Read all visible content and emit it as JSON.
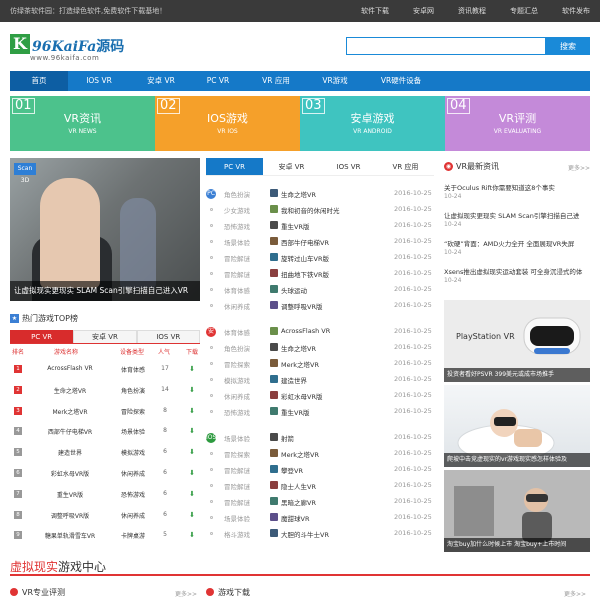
{
  "topbar": {
    "slogan": "仿绿茶软件园：打造绿色软件,免费软件下载基地！",
    "links": [
      "软件下载",
      "安卓网",
      "资讯教程",
      "专题汇总",
      "软件发布"
    ]
  },
  "logo": {
    "k": "K",
    "name_latin": "96KaiFa",
    "name_cn": "源码",
    "url": "www.96kaifa.com"
  },
  "search": {
    "placeholder": "",
    "button": "搜索"
  },
  "nav": [
    "首页",
    "IOS VR",
    "安卓 VR",
    "PC VR",
    "VR 应用",
    "VR游戏",
    "VR硬件设备"
  ],
  "categories": [
    {
      "num": "01",
      "title": "VR资讯",
      "sub": "VR NEWS",
      "color": "#4cc28c"
    },
    {
      "num": "02",
      "title": "IOS游戏",
      "sub": "VR IOS",
      "color": "#f5a02a"
    },
    {
      "num": "03",
      "title": "安卓游戏",
      "sub": "VR ANDROID",
      "color": "#3fc4c0"
    },
    {
      "num": "04",
      "title": "VR评测",
      "sub": "VR EVALUATING",
      "color": "#c48ad9"
    }
  ],
  "banner": {
    "badge": "Scan 3D",
    "caption": "让虚拟现实更现实 SLAM Scan引擎扫描自己进入VR"
  },
  "hot": {
    "title": "热门游戏TOP榜",
    "tabs": [
      "PC VR",
      "安卓 VR",
      "IOS VR"
    ],
    "columns": [
      "排名",
      "游戏名称",
      "设备类型",
      "人气",
      "下载"
    ],
    "rows": [
      {
        "rank": "1",
        "name": "AcrossFlash VR",
        "type": "体育体感",
        "pop": "17"
      },
      {
        "rank": "2",
        "name": "生命之塔VR",
        "type": "角色扮演",
        "pop": "14"
      },
      {
        "rank": "3",
        "name": "Merk之塔VR",
        "type": "冒险探索",
        "pop": "8"
      },
      {
        "rank": "4",
        "name": "西部牛仔电梯VR",
        "type": "场景体验",
        "pop": "8"
      },
      {
        "rank": "5",
        "name": "建造世界",
        "type": "模拟游戏",
        "pop": "6"
      },
      {
        "rank": "6",
        "name": "彩虹水母VR版",
        "type": "休闲养成",
        "pop": "6"
      },
      {
        "rank": "7",
        "name": "重生VR版",
        "type": "恐怖游戏",
        "pop": "6"
      },
      {
        "rank": "8",
        "name": "调整呼吸VR版",
        "type": "休闲养成",
        "pop": "6"
      },
      {
        "rank": "9",
        "name": "糖果单轨滑雪车VR",
        "type": "卡牌桌游",
        "pop": "5"
      }
    ]
  },
  "mid": {
    "tabs": [
      "PC VR",
      "安卓 VR",
      "IOS VR",
      "VR 应用"
    ],
    "groups": [
      {
        "icon": "PC",
        "color": "#3b7fd4",
        "rows": [
          {
            "cat": "角色扮演",
            "title": "生命之塔VR",
            "date": "2016-10-25"
          },
          {
            "cat": "少女游戏",
            "title": "我和初音的休闲时光",
            "date": "2016-10-25"
          },
          {
            "cat": "恐怖游戏",
            "title": "重生VR版",
            "date": "2016-10-25"
          },
          {
            "cat": "场景体验",
            "title": "西部牛仔电梯VR",
            "date": "2016-10-25"
          },
          {
            "cat": "冒险解谜",
            "title": "旋转过山车VR版",
            "date": "2016-10-25"
          },
          {
            "cat": "冒险解谜",
            "title": "扭曲地下铁VR版",
            "date": "2016-10-25"
          },
          {
            "cat": "体育体感",
            "title": "头球运动",
            "date": "2016-10-25"
          },
          {
            "cat": "休闲养成",
            "title": "调整呼吸VR版",
            "date": "2016-10-25"
          }
        ]
      },
      {
        "icon": "安",
        "color": "#e03434",
        "rows": [
          {
            "cat": "体育体感",
            "title": "AcrossFlash VR",
            "date": "2016-10-25"
          },
          {
            "cat": "角色扮演",
            "title": "生命之塔VR",
            "date": "2016-10-25"
          },
          {
            "cat": "冒险探索",
            "title": "Merk之塔VR",
            "date": "2016-10-25"
          },
          {
            "cat": "模拟游戏",
            "title": "建造世界",
            "date": "2016-10-25"
          },
          {
            "cat": "休闲养成",
            "title": "彩虹水母VR版",
            "date": "2016-10-25"
          },
          {
            "cat": "恐怖游戏",
            "title": "重生VR版",
            "date": "2016-10-25"
          }
        ]
      },
      {
        "icon": "IOS",
        "color": "#2d9a3f",
        "rows": [
          {
            "cat": "场景体验",
            "title": "射箭",
            "date": "2016-10-25"
          },
          {
            "cat": "冒险探索",
            "title": "Merk之塔VR",
            "date": "2016-10-25"
          },
          {
            "cat": "冒险解谜",
            "title": "攀登VR",
            "date": "2016-10-25"
          },
          {
            "cat": "冒险解谜",
            "title": "隐士人生VR",
            "date": "2016-10-25"
          },
          {
            "cat": "冒险解谜",
            "title": "黑暗之廊VR",
            "date": "2016-10-25"
          },
          {
            "cat": "场景体验",
            "title": "魔甜球VR",
            "date": "2016-10-25"
          },
          {
            "cat": "格斗游戏",
            "title": "大胆的斗牛士VR",
            "date": "2016-10-25"
          }
        ]
      }
    ]
  },
  "news": {
    "title": "VR最新资讯",
    "more": "更多>>",
    "items": [
      {
        "title": "关于Oculus Rift你需要知道这8个事实",
        "date": "10-24"
      },
      {
        "title": "让虚拟现实更现实 SLAM Scan引擎扫描自己进",
        "date": "10-24"
      },
      {
        "title": "“砍硬”背面：AMD火力全开 全面展现VR失屏",
        "date": "10-24"
      },
      {
        "title": "Xsens推出虚拟现实运动套装 可全身沉浸式的体",
        "date": "10-24"
      }
    ]
  },
  "pics": [
    {
      "caption": "投资者看好PSVR 399美元或成市场推手",
      "brand": "PlayStation VR"
    },
    {
      "caption": "爬坡中击竞虚现实的vr游戏现实感怎样体验及",
      "brand": ""
    },
    {
      "caption": "淘宝buy加什么时候上市 淘宝buy+上市时间",
      "brand": ""
    }
  ],
  "section": {
    "title_red": "虚拟现实",
    "title_dark": "游戏中心"
  },
  "subs": [
    {
      "title": "VR专业评测",
      "more": "更多>>"
    },
    {
      "title": "游戏下载",
      "more": "更多>>"
    }
  ]
}
